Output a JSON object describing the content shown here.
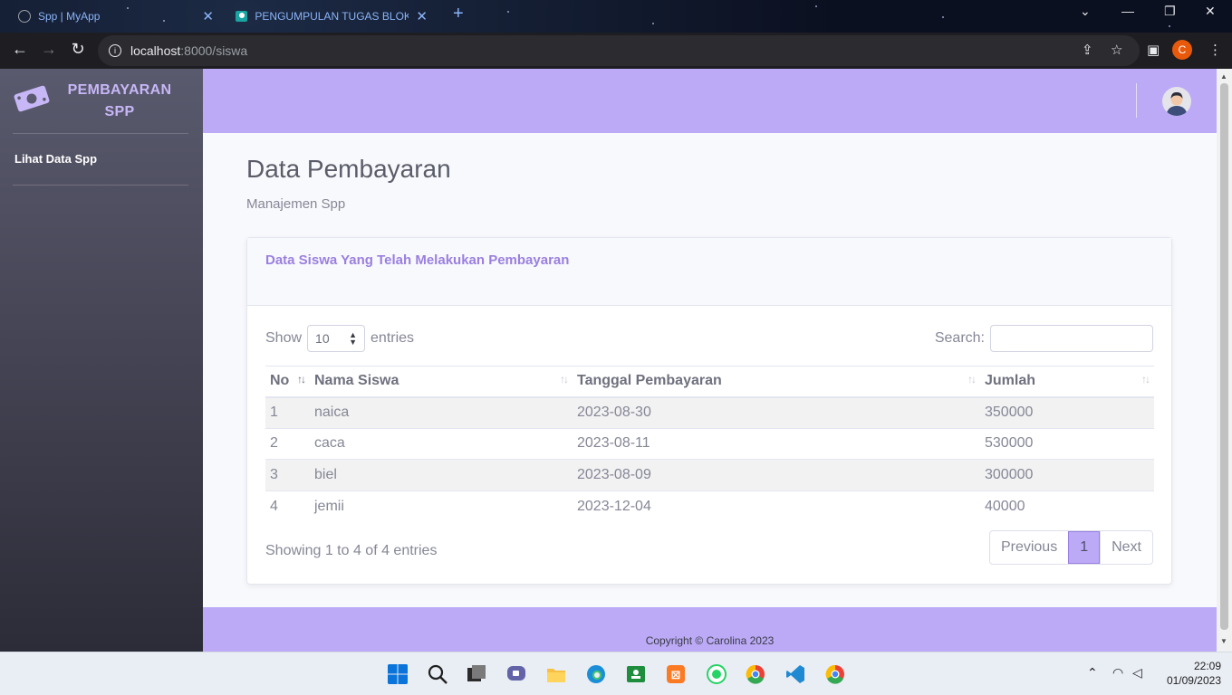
{
  "browser": {
    "tabs": [
      {
        "title": "Spp | MyApp"
      },
      {
        "title": "PENGUMPULAN TUGAS BLOKING"
      }
    ],
    "url_host": "localhost",
    "url_path": ":8000/siswa",
    "profile_initial": "C"
  },
  "sidebar": {
    "brand_line1": "PEMBAYARAN",
    "brand_line2": "SPP",
    "items": [
      {
        "label": "Lihat Data Spp"
      }
    ]
  },
  "page": {
    "title": "Data Pembayaran",
    "subtitle": "Manajemen Spp"
  },
  "card": {
    "title": "Data Siswa Yang Telah Melakukan Pembayaran",
    "show_label": "Show",
    "entries_label": "entries",
    "page_length": "10",
    "search_label": "Search:",
    "search_value": "",
    "columns": [
      "No",
      "Nama Siswa",
      "Tanggal Pembayaran",
      "Jumlah"
    ],
    "rows": [
      {
        "no": "1",
        "nama": "naica",
        "tanggal": "2023-08-30",
        "jumlah": "350000"
      },
      {
        "no": "2",
        "nama": "caca",
        "tanggal": "2023-08-11",
        "jumlah": "530000"
      },
      {
        "no": "3",
        "nama": "biel",
        "tanggal": "2023-08-09",
        "jumlah": "300000"
      },
      {
        "no": "4",
        "nama": "jemii",
        "tanggal": "2023-12-04",
        "jumlah": "40000"
      }
    ],
    "info": "Showing 1 to 4 of 4 entries",
    "pagination": {
      "previous": "Previous",
      "current": "1",
      "next": "Next"
    }
  },
  "footer": {
    "copyright": "Copyright © Carolina 2023"
  },
  "taskbar": {
    "time": "22:09",
    "date": "01/09/2023"
  },
  "colors": {
    "accent": "#bcaaf7",
    "accent_text": "#9a7fe0",
    "sidebar_top": "#5a5a6e",
    "sidebar_bottom": "#2c2c38"
  }
}
